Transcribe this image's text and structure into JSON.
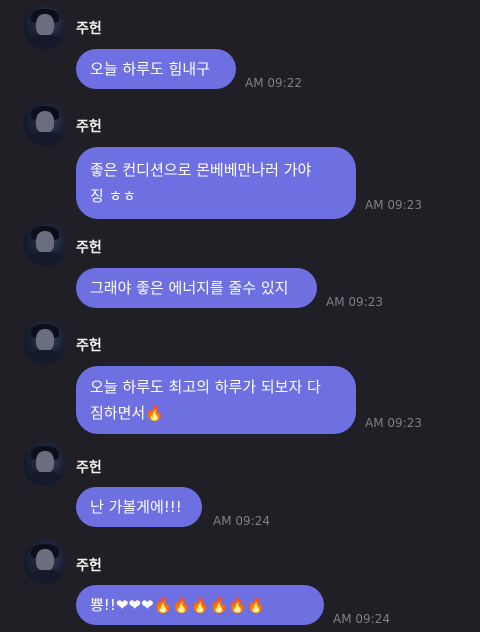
{
  "messages": [
    {
      "sender": "주헌",
      "text": "오늘 하루도 힘내구",
      "time": "AM 09:22"
    },
    {
      "sender": "주헌",
      "text": "좋은 컨디션으로 몬베베만나러 가야\n징 ㅎㅎ",
      "time": "AM 09:23"
    },
    {
      "sender": "주헌",
      "text": "그래야 좋은 에너지를 줄수 있지",
      "time": "AM 09:23"
    },
    {
      "sender": "주헌",
      "text": "오늘 하루도 최고의 하루가 되보자 다\n짐하면서🔥",
      "time": "AM 09:23"
    },
    {
      "sender": "주헌",
      "text": "난 가볼게에!!!",
      "time": "AM 09:24"
    },
    {
      "sender": "주헌",
      "text": "뿅!!❤❤❤🔥🔥🔥🔥🔥🔥",
      "time": "AM 09:24"
    }
  ],
  "colors": {
    "background": "#1f1f25",
    "bubble": "#6e6fe0",
    "time": "#7f7f86"
  }
}
